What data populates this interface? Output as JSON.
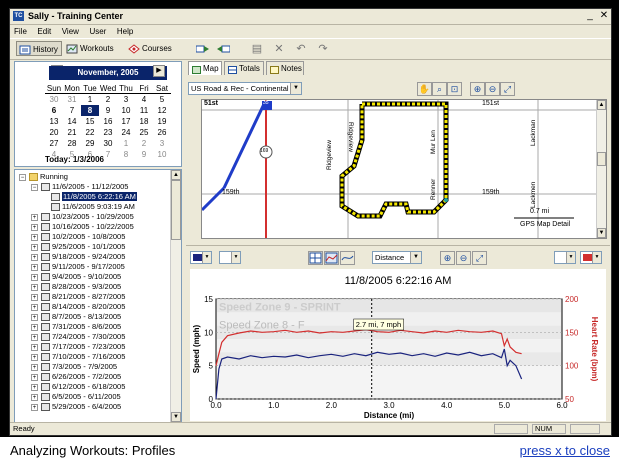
{
  "window": {
    "title": "Sally - Training Center",
    "app_icon": "TC"
  },
  "menu": [
    "File",
    "Edit",
    "View",
    "User",
    "Help"
  ],
  "toolbar": {
    "history": "History",
    "workouts": "Workouts",
    "courses": "Courses"
  },
  "calendar": {
    "month": "November, 2005",
    "dow": [
      "Sun",
      "Mon",
      "Tue",
      "Wed",
      "Thu",
      "Fri",
      "Sat"
    ],
    "weeks": [
      [
        "30",
        "31",
        "1",
        "2",
        "3",
        "4",
        "5"
      ],
      [
        "6",
        "7",
        "8",
        "9",
        "10",
        "11",
        "12"
      ],
      [
        "13",
        "14",
        "15",
        "16",
        "17",
        "18",
        "19"
      ],
      [
        "20",
        "21",
        "22",
        "23",
        "24",
        "25",
        "26"
      ],
      [
        "27",
        "28",
        "29",
        "30",
        "1",
        "2",
        "3"
      ],
      [
        "4",
        "5",
        "6",
        "7",
        "8",
        "9",
        "10"
      ]
    ],
    "today": "Today: 1/3/2006"
  },
  "tree": {
    "root": "Running",
    "expanded_week": "11/6/2005 - 11/12/2005",
    "workouts": [
      "11/8/2005 6:22:16 AM",
      "11/6/2005 9:03:19 AM"
    ],
    "weeks": [
      "10/23/2005 - 10/29/2005",
      "10/16/2005 - 10/22/2005",
      "10/2/2005 - 10/8/2005",
      "9/25/2005 - 10/1/2005",
      "9/18/2005 - 9/24/2005",
      "9/11/2005 - 9/17/2005",
      "9/4/2005 - 9/10/2005",
      "8/28/2005 - 9/3/2005",
      "8/21/2005 - 8/27/2005",
      "8/14/2005 - 8/20/2005",
      "8/7/2005 - 8/13/2005",
      "7/31/2005 - 8/6/2005",
      "7/24/2005 - 7/30/2005",
      "7/17/2005 - 7/23/2005",
      "7/10/2005 - 7/16/2005",
      "7/3/2005 - 7/9/2005",
      "6/26/2005 - 7/2/2005",
      "6/12/2005 - 6/18/2005",
      "6/5/2005 - 6/11/2005",
      "5/29/2005 - 6/4/2005"
    ]
  },
  "map": {
    "tabs": [
      "Map",
      "Totals",
      "Notes"
    ],
    "map_source": "US Road & Rec - Continental US",
    "labels": {
      "top_left": "51st",
      "top_right": "151st",
      "ave1": "Ridgeview",
      "ave2": "Mur Len",
      "ave3": "Lackman",
      "ave4": "Lackmen",
      "ave5": "Renner",
      "bottom_left": "159th",
      "bottom_right": "159th",
      "top_ave": "Ridgeview",
      "hwy1": "35",
      "hwy2": "169"
    },
    "scale_label": "0.7 mi",
    "footer": "GPS Map Detail"
  },
  "chart_toolbar": {
    "x_axis_select": "Distance"
  },
  "chart_data": {
    "type": "line",
    "title": "11/8/2005 6:22:16 AM",
    "xlabel": "Distance (mi)",
    "ylabel_left": "Speed (mph)",
    "ylabel_right": "Heart Rate (bpm)",
    "xlim": [
      0.0,
      6.0
    ],
    "xticks": [
      "0.0",
      "1.0",
      "2.0",
      "3.0",
      "4.0",
      "5.0",
      "6.0"
    ],
    "ylim_left": [
      0,
      15
    ],
    "yticks_left": [
      "0",
      "5",
      "10",
      "15"
    ],
    "ylim_right": [
      50,
      200
    ],
    "yticks_right": [
      "50",
      "100",
      "150",
      "200"
    ],
    "zones": [
      "Speed Zone 9 - SPRINT",
      "Speed Zone 8 - F"
    ],
    "tooltip": "2.7 mi, 7 mph",
    "cursor_x": 2.7,
    "grid": true,
    "series": [
      {
        "name": "Speed",
        "color": "#1a237e",
        "axis": "left",
        "x": [
          0.0,
          0.05,
          0.1,
          0.2,
          0.4,
          0.6,
          0.8,
          1.0,
          1.2,
          1.4,
          1.6,
          1.8,
          2.0,
          2.2,
          2.4,
          2.6,
          2.8,
          3.0,
          3.2,
          3.4,
          3.6,
          3.8,
          4.0,
          4.2,
          4.4,
          4.6,
          4.8,
          4.95,
          5.0,
          5.05,
          5.1,
          5.2,
          5.3
        ],
        "y": [
          0,
          4.5,
          6.0,
          6.3,
          6.0,
          6.5,
          6.2,
          6.4,
          6.3,
          6.6,
          6.2,
          6.5,
          6.7,
          6.4,
          6.8,
          6.5,
          7.0,
          6.7,
          6.9,
          6.5,
          6.8,
          6.4,
          6.9,
          6.6,
          7.0,
          6.5,
          6.8,
          6.2,
          7.5,
          5.0,
          5.8,
          5.0,
          3.0
        ]
      },
      {
        "name": "Heart Rate",
        "color": "#d32f2f",
        "axis": "right",
        "x": [
          0.0,
          0.05,
          0.1,
          0.2,
          0.4,
          0.6,
          0.8,
          1.0,
          1.2,
          1.4,
          1.6,
          1.8,
          2.0,
          2.2,
          2.4,
          2.6,
          2.8,
          3.0,
          3.2,
          3.4,
          3.6,
          3.8,
          4.0,
          4.2,
          4.4,
          4.6,
          4.8,
          4.95,
          5.0,
          5.05,
          5.1,
          5.2,
          5.3
        ],
        "y": [
          100,
          118,
          135,
          145,
          149,
          152,
          150,
          151,
          153,
          150,
          152,
          149,
          151,
          150,
          152,
          154,
          151,
          150,
          153,
          151,
          149,
          152,
          150,
          153,
          151,
          150,
          152,
          148,
          130,
          140,
          128,
          120,
          118
        ]
      }
    ]
  },
  "status": {
    "left": "Ready",
    "num": "NUM"
  },
  "caption": {
    "text": "Analyzing Workouts: Profiles",
    "close": "press x to close"
  }
}
